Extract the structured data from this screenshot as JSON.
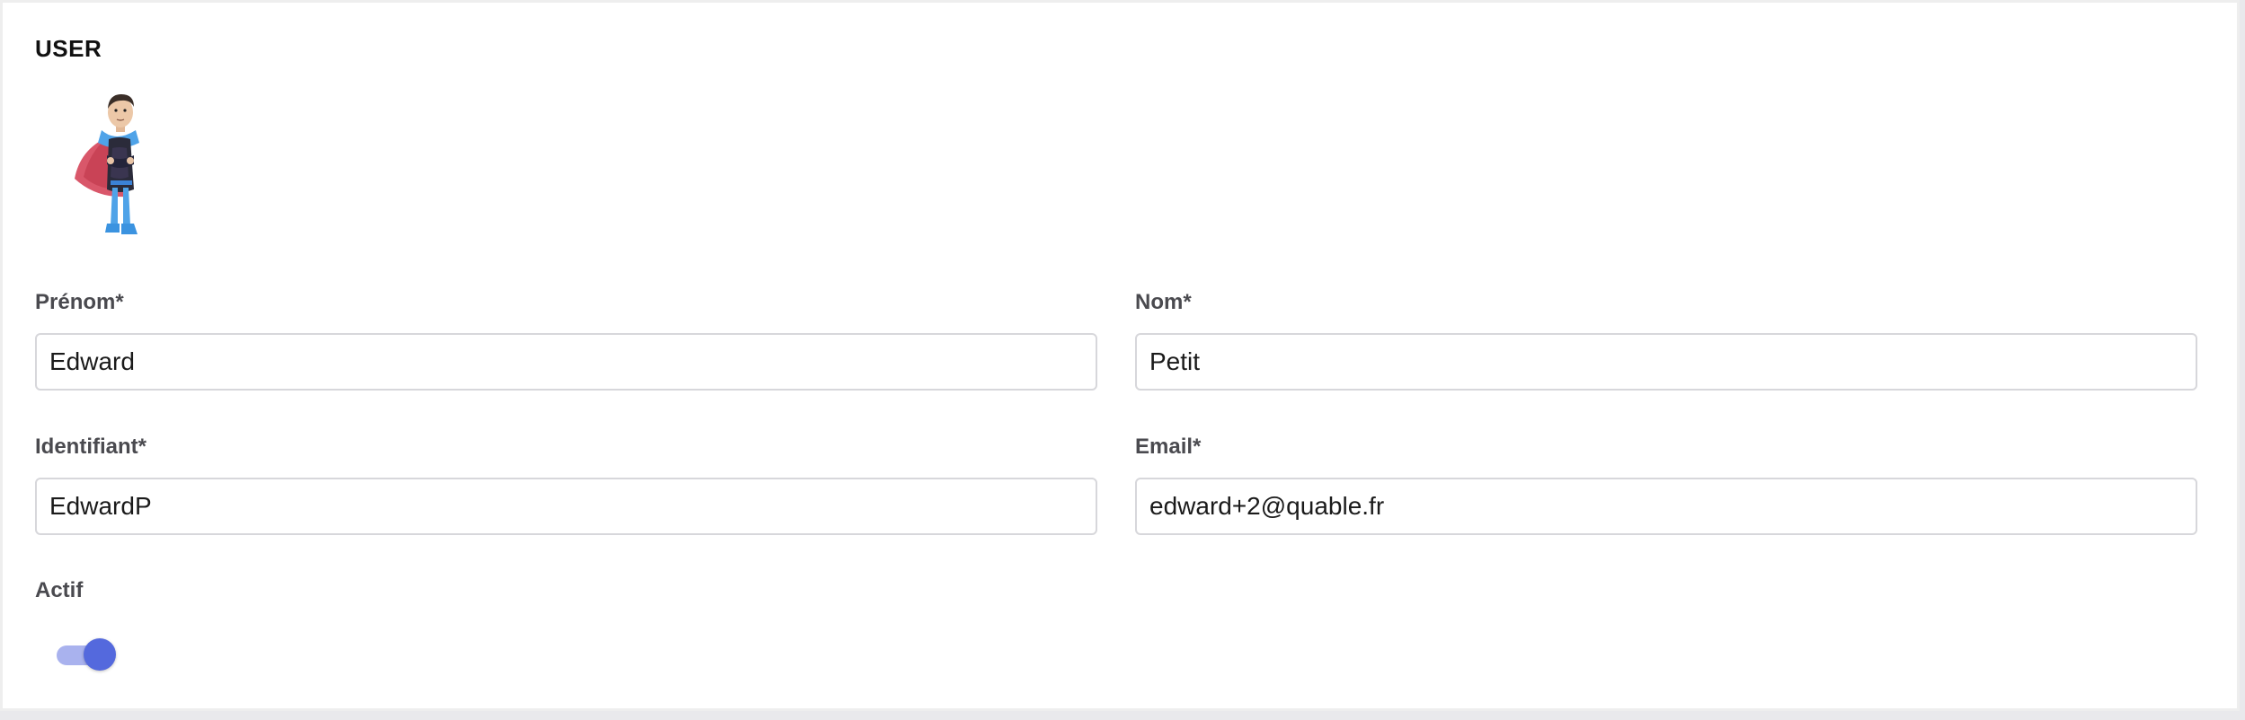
{
  "section": {
    "title": "USER"
  },
  "form": {
    "first_name": {
      "label": "Prénom*",
      "value": "Edward"
    },
    "last_name": {
      "label": "Nom*",
      "value": "Petit"
    },
    "username": {
      "label": "Identifiant*",
      "value": "EdwardP"
    },
    "email": {
      "label": "Email*",
      "value": "edward+2@quable.fr"
    },
    "active": {
      "label": "Actif",
      "checked": true
    }
  },
  "colors": {
    "toggle_track": "#a9b2ee",
    "toggle_knob": "#5469dd",
    "avatar_cape": "#d9576a",
    "avatar_cape_lining": "#4fa3e8"
  },
  "avatar": {
    "icon": "superhero-avatar-icon"
  }
}
